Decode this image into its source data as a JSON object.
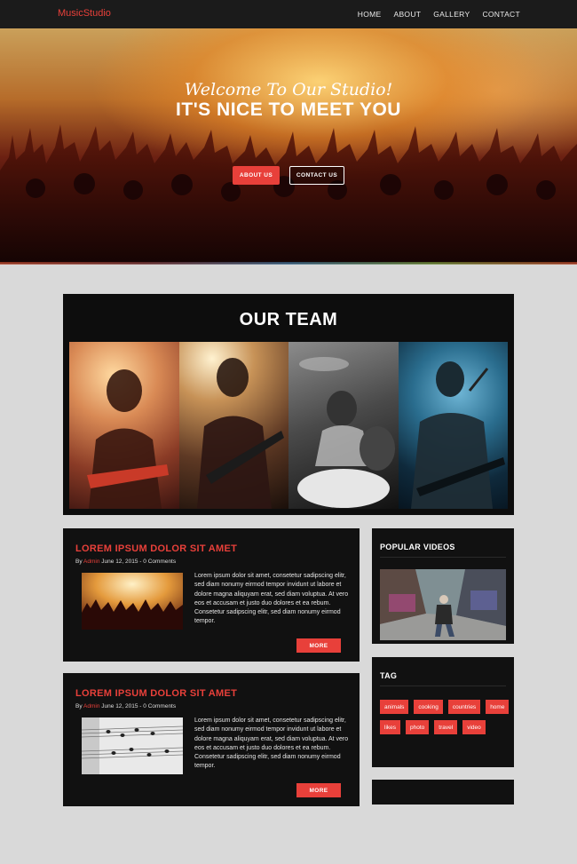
{
  "nav": {
    "brand": "MusicStudio",
    "items": [
      "HOME",
      "ABOUT",
      "GALLERY",
      "CONTACT"
    ]
  },
  "hero": {
    "script": "Welcome To Our Studio!",
    "title": "IT'S NICE TO MEET YOU",
    "btn_about": "ABOUT US",
    "btn_contact": "CONTACT US"
  },
  "team": {
    "title": "OUR TEAM"
  },
  "posts": [
    {
      "title": "LOREM IPSUM DOLOR SIT AMET",
      "meta_by": "By ",
      "author": "Admin",
      "meta_rest": " June 12, 2015 - 0 Comments",
      "text": "Lorem ipsum dolor sit amet, consetetur sadipscing elitr, sed diam nonumy eirmod tempor invidunt ut labore et dolore magna aliquyam erat, sed diam voluptua. At vero eos et accusam et justo duo dolores et ea rebum. Consetetur sadipscing elitr, sed diam nonumy eirmod tempor.",
      "more": "MORE"
    },
    {
      "title": "LOREM IPSUM DOLOR SIT AMET",
      "meta_by": "By ",
      "author": "Admin",
      "meta_rest": " June 12, 2015 - 0 Comments",
      "text": "Lorem ipsum dolor sit amet, consetetur sadipscing elitr, sed diam nonumy eirmod tempor invidunt ut labore et dolore magna aliquyam erat, sed diam voluptua. At vero eos et accusam et justo duo dolores et ea rebum. Consetetur sadipscing elitr, sed diam nonumy eirmod tempor.",
      "more": "MORE"
    }
  ],
  "sidebar": {
    "videos_title": "POPULAR VIDEOS",
    "tag_title": "TAG",
    "tags": [
      "animals",
      "cooking",
      "countries",
      "home",
      "likes",
      "photo",
      "travel",
      "video"
    ]
  },
  "colors": {
    "accent": "#e8403a",
    "nav_bg": "#1b1b1b",
    "panel_bg": "#111111",
    "page_bg": "#d9d9d9"
  }
}
